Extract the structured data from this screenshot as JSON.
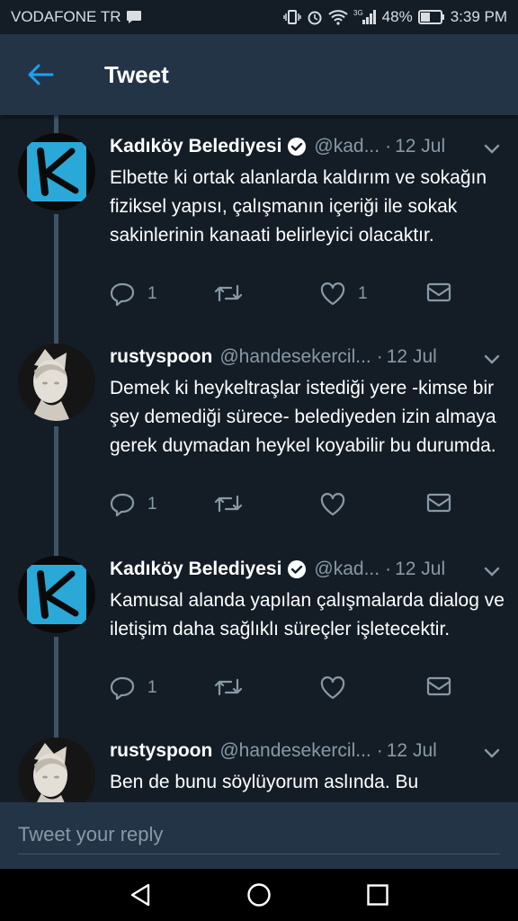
{
  "status_bar": {
    "carrier": "VODAFONE TR",
    "battery": "48%",
    "time": "3:39 PM",
    "signal_label": "3G"
  },
  "header": {
    "title": "Tweet"
  },
  "tweets": [
    {
      "author": "Kadıköy Belediyesi",
      "verified": true,
      "handle": "@kad...",
      "date": "12 Jul",
      "text": "Elbette ki ortak alanlarda kaldırım ve sokağın fiziksel yapısı, çalışmanın içeriği ile sokak sakinlerinin kanaati belirleyici olacaktır.",
      "reply_count": "1",
      "like_count": "1"
    },
    {
      "author": "rustyspoon",
      "verified": false,
      "handle": "@handesekercil...",
      "date": "12 Jul",
      "text": "Demek ki heykeltraşlar istediği yere -kimse bir şey demediği sürece- belediyeden izin almaya gerek duymadan heykel koyabilir bu durumda.",
      "reply_count": "1",
      "like_count": ""
    },
    {
      "author": "Kadıköy Belediyesi",
      "verified": true,
      "handle": "@kad...",
      "date": "12 Jul",
      "text": "Kamusal alanda yapılan çalışmalarda dialog ve iletişim daha sağlıklı süreçler işletecektir.",
      "reply_count": "1",
      "like_count": ""
    },
    {
      "author": "rustyspoon",
      "verified": false,
      "handle": "@handesekercil...",
      "date": "12 Jul",
      "text": "Ben de bunu söylüyorum aslında. Bu sokamalar başka yerde de karşıma",
      "reply_count": "",
      "like_count": ""
    }
  ],
  "reply": {
    "placeholder": "Tweet your reply"
  },
  "colors": {
    "background": "#141d26",
    "header": "#243447",
    "accent": "#1da1f2",
    "muted": "#8899a6",
    "kadikoy_logo": "#2aa8d8"
  }
}
